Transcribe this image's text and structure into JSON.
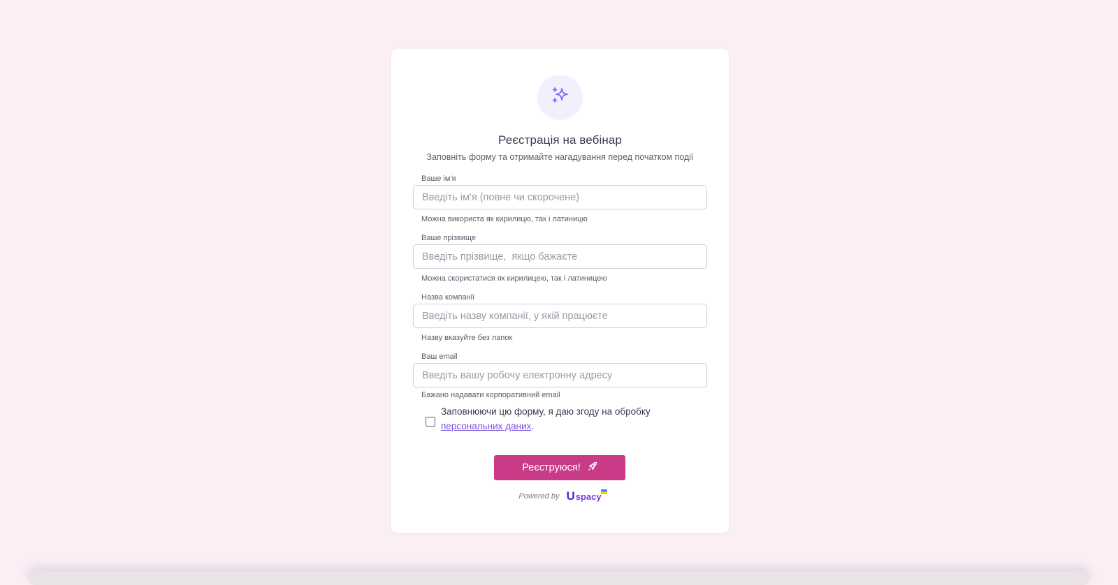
{
  "form": {
    "title": "Реєстрація на вебінар",
    "subtitle": "Заповніть форму та отримайте нагадування перед початком події",
    "header_icon": "sparkles-icon",
    "fields": [
      {
        "label": "Ваше ім'я",
        "placeholder": "Введіть ім'я (повне чи скорочене)",
        "value": "",
        "hint": "Можна використа як кирилицю, так і латиницю"
      },
      {
        "label": "Ваше прізвище",
        "placeholder": "Введіть прізвище,  якщо бажаєте",
        "value": "",
        "hint": "Можна скористатися як кирилицею, так і латиницею"
      },
      {
        "label": "Назва компанії",
        "placeholder": "Введіть назву компанії, у якій працюєте",
        "value": "",
        "hint": "Назву вказуйте без лапок"
      },
      {
        "label": "Ваш email",
        "placeholder": "Введіть вашу робочу електронну адресу",
        "value": "",
        "hint": "Бажано надавати корпоративний email"
      }
    ],
    "consent": {
      "text": "Заповнюючи цю форму, я даю згоду на обробку",
      "link_text": "персональних даних",
      "suffix": ".",
      "checked": false
    },
    "submit": {
      "label": "Реєструюся!",
      "icon": "rocket-icon"
    },
    "footer": {
      "powered_by": "Powered by",
      "logo_mark": "U",
      "logo_text": "spacy"
    }
  },
  "colors": {
    "page_background": "#fbeef5",
    "card_background": "#ffffff",
    "accent_button": "#c93b87",
    "icon_accent": "#8b5cf6",
    "link": "#7b52e0"
  }
}
